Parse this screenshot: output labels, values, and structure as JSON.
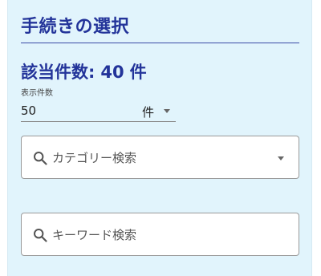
{
  "procedure_select": {
    "title": "手続きの選択",
    "result_count": {
      "label": "該当件数:",
      "value": "40",
      "unit": "件"
    },
    "per_page": {
      "caption": "表示件数",
      "value": "50",
      "unit": "件"
    },
    "category_search": {
      "placeholder": "カテゴリー検索",
      "icon": "search-icon"
    },
    "keyword_search": {
      "placeholder": "キーワード検索",
      "icon": "search-icon"
    }
  },
  "colors": {
    "panel_background": "#e1f4fc",
    "heading": "#23349a",
    "field_background": "#ffffff",
    "field_border": "#9a9a9a"
  }
}
